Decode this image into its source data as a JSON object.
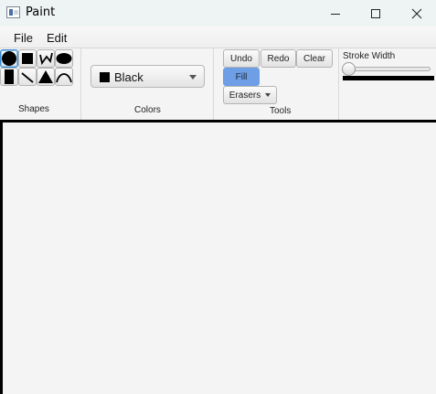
{
  "window": {
    "title": "Paint",
    "controls": [
      "minimize-icon",
      "maximize-icon",
      "close-icon"
    ]
  },
  "menubar": {
    "items": [
      {
        "label": "File"
      },
      {
        "label": "Edit"
      }
    ]
  },
  "toolbar": {
    "shapes": {
      "label": "Shapes",
      "tools": [
        {
          "name": "circle-icon",
          "selected": true
        },
        {
          "name": "square-icon",
          "selected": false
        },
        {
          "name": "freehand-icon",
          "selected": false
        },
        {
          "name": "ellipse-icon",
          "selected": false
        },
        {
          "name": "rectangle-icon",
          "selected": false
        },
        {
          "name": "line-icon",
          "selected": false
        },
        {
          "name": "triangle-icon",
          "selected": false
        },
        {
          "name": "curve-icon",
          "selected": false
        }
      ]
    },
    "colors": {
      "label": "Colors",
      "selected": "Black",
      "swatch": "#000000"
    },
    "tools": {
      "label": "Tools",
      "undo": "Undo",
      "redo": "Redo",
      "clear": "Clear",
      "fill": "Fill",
      "fill_active_color": "#6d9ee6",
      "erasers": "Erasers"
    },
    "stroke": {
      "label": "Stroke Width",
      "value_fraction": 0.0
    }
  }
}
